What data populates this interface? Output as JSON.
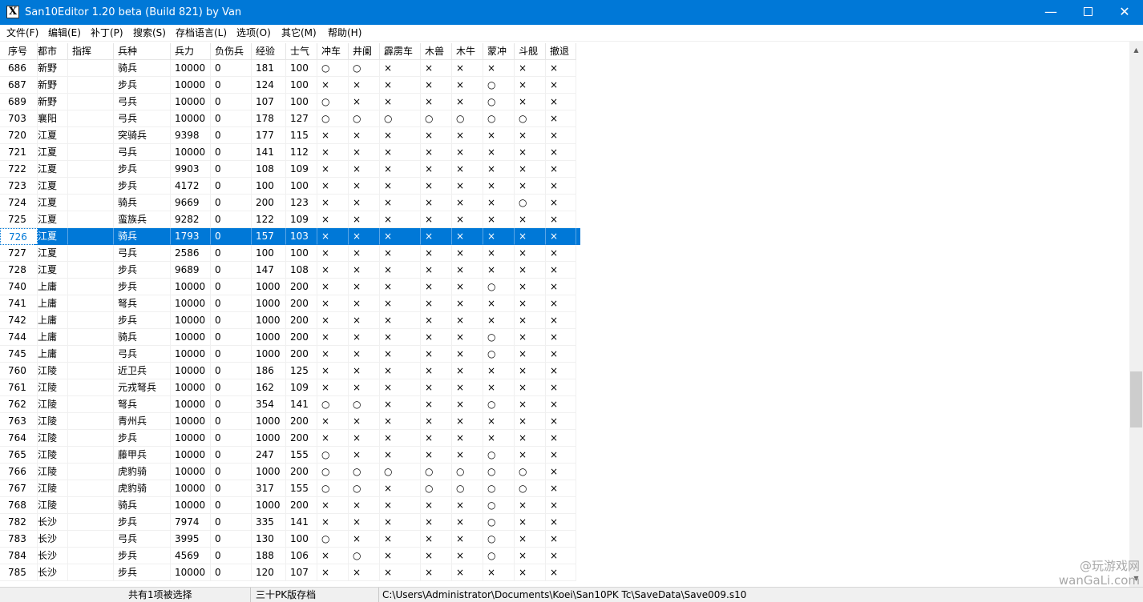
{
  "window": {
    "title": "San10Editor 1.20 beta (Build 821) by Van",
    "icon": "X",
    "minimize": "—",
    "close": "✕"
  },
  "menu": [
    "文件(F)",
    "编辑(E)",
    "补丁(P)",
    "搜索(S)",
    "存档语言(L)",
    "选项(O)",
    "其它(M)",
    "帮助(H)"
  ],
  "table": {
    "columns": [
      "序号",
      "都市",
      "指挥",
      "兵种",
      "兵力",
      "负伤兵",
      "经验",
      "士气",
      "冲车",
      "井阑",
      "霹雳车",
      "木兽",
      "木牛",
      "蒙冲",
      "斗舰",
      "撤退"
    ],
    "rows": [
      [
        "686",
        "新野",
        "",
        "骑兵",
        "10000",
        "0",
        "181",
        "100",
        "○",
        "○",
        "×",
        "×",
        "×",
        "×",
        "×",
        "×"
      ],
      [
        "687",
        "新野",
        "",
        "步兵",
        "10000",
        "0",
        "124",
        "100",
        "×",
        "×",
        "×",
        "×",
        "×",
        "○",
        "×",
        "×"
      ],
      [
        "689",
        "新野",
        "",
        "弓兵",
        "10000",
        "0",
        "107",
        "100",
        "○",
        "×",
        "×",
        "×",
        "×",
        "○",
        "×",
        "×"
      ],
      [
        "703",
        "襄阳",
        "",
        "弓兵",
        "10000",
        "0",
        "178",
        "127",
        "○",
        "○",
        "○",
        "○",
        "○",
        "○",
        "○",
        "×"
      ],
      [
        "720",
        "江夏",
        "",
        "突骑兵",
        "9398",
        "0",
        "177",
        "115",
        "×",
        "×",
        "×",
        "×",
        "×",
        "×",
        "×",
        "×"
      ],
      [
        "721",
        "江夏",
        "",
        "弓兵",
        "10000",
        "0",
        "141",
        "112",
        "×",
        "×",
        "×",
        "×",
        "×",
        "×",
        "×",
        "×"
      ],
      [
        "722",
        "江夏",
        "",
        "步兵",
        "9903",
        "0",
        "108",
        "109",
        "×",
        "×",
        "×",
        "×",
        "×",
        "×",
        "×",
        "×"
      ],
      [
        "723",
        "江夏",
        "",
        "步兵",
        "4172",
        "0",
        "100",
        "100",
        "×",
        "×",
        "×",
        "×",
        "×",
        "×",
        "×",
        "×"
      ],
      [
        "724",
        "江夏",
        "",
        "骑兵",
        "9669",
        "0",
        "200",
        "123",
        "×",
        "×",
        "×",
        "×",
        "×",
        "×",
        "○",
        "×"
      ],
      [
        "725",
        "江夏",
        "",
        "蛮族兵",
        "9282",
        "0",
        "122",
        "109",
        "×",
        "×",
        "×",
        "×",
        "×",
        "×",
        "×",
        "×"
      ],
      [
        "726",
        "江夏",
        "",
        "骑兵",
        "1793",
        "0",
        "157",
        "103",
        "×",
        "×",
        "×",
        "×",
        "×",
        "×",
        "×",
        "×"
      ],
      [
        "727",
        "江夏",
        "",
        "弓兵",
        "2586",
        "0",
        "100",
        "100",
        "×",
        "×",
        "×",
        "×",
        "×",
        "×",
        "×",
        "×"
      ],
      [
        "728",
        "江夏",
        "",
        "步兵",
        "9689",
        "0",
        "147",
        "108",
        "×",
        "×",
        "×",
        "×",
        "×",
        "×",
        "×",
        "×"
      ],
      [
        "740",
        "上庸",
        "",
        "步兵",
        "10000",
        "0",
        "1000",
        "200",
        "×",
        "×",
        "×",
        "×",
        "×",
        "○",
        "×",
        "×"
      ],
      [
        "741",
        "上庸",
        "",
        "弩兵",
        "10000",
        "0",
        "1000",
        "200",
        "×",
        "×",
        "×",
        "×",
        "×",
        "×",
        "×",
        "×"
      ],
      [
        "742",
        "上庸",
        "",
        "步兵",
        "10000",
        "0",
        "1000",
        "200",
        "×",
        "×",
        "×",
        "×",
        "×",
        "×",
        "×",
        "×"
      ],
      [
        "744",
        "上庸",
        "",
        "骑兵",
        "10000",
        "0",
        "1000",
        "200",
        "×",
        "×",
        "×",
        "×",
        "×",
        "○",
        "×",
        "×"
      ],
      [
        "745",
        "上庸",
        "",
        "弓兵",
        "10000",
        "0",
        "1000",
        "200",
        "×",
        "×",
        "×",
        "×",
        "×",
        "○",
        "×",
        "×"
      ],
      [
        "760",
        "江陵",
        "",
        "近卫兵",
        "10000",
        "0",
        "186",
        "125",
        "×",
        "×",
        "×",
        "×",
        "×",
        "×",
        "×",
        "×"
      ],
      [
        "761",
        "江陵",
        "",
        "元戎弩兵",
        "10000",
        "0",
        "162",
        "109",
        "×",
        "×",
        "×",
        "×",
        "×",
        "×",
        "×",
        "×"
      ],
      [
        "762",
        "江陵",
        "",
        "弩兵",
        "10000",
        "0",
        "354",
        "141",
        "○",
        "○",
        "×",
        "×",
        "×",
        "○",
        "×",
        "×"
      ],
      [
        "763",
        "江陵",
        "",
        "青州兵",
        "10000",
        "0",
        "1000",
        "200",
        "×",
        "×",
        "×",
        "×",
        "×",
        "×",
        "×",
        "×"
      ],
      [
        "764",
        "江陵",
        "",
        "步兵",
        "10000",
        "0",
        "1000",
        "200",
        "×",
        "×",
        "×",
        "×",
        "×",
        "×",
        "×",
        "×"
      ],
      [
        "765",
        "江陵",
        "",
        "藤甲兵",
        "10000",
        "0",
        "247",
        "155",
        "○",
        "×",
        "×",
        "×",
        "×",
        "○",
        "×",
        "×"
      ],
      [
        "766",
        "江陵",
        "",
        "虎豹骑",
        "10000",
        "0",
        "1000",
        "200",
        "○",
        "○",
        "○",
        "○",
        "○",
        "○",
        "○",
        "×"
      ],
      [
        "767",
        "江陵",
        "",
        "虎豹骑",
        "10000",
        "0",
        "317",
        "155",
        "○",
        "○",
        "×",
        "○",
        "○",
        "○",
        "○",
        "×"
      ],
      [
        "768",
        "江陵",
        "",
        "骑兵",
        "10000",
        "0",
        "1000",
        "200",
        "×",
        "×",
        "×",
        "×",
        "×",
        "○",
        "×",
        "×"
      ],
      [
        "782",
        "长沙",
        "",
        "步兵",
        "7974",
        "0",
        "335",
        "141",
        "×",
        "×",
        "×",
        "×",
        "×",
        "○",
        "×",
        "×"
      ],
      [
        "783",
        "长沙",
        "",
        "弓兵",
        "3995",
        "0",
        "130",
        "100",
        "○",
        "×",
        "×",
        "×",
        "×",
        "○",
        "×",
        "×"
      ],
      [
        "784",
        "长沙",
        "",
        "步兵",
        "4569",
        "0",
        "188",
        "106",
        "×",
        "○",
        "×",
        "×",
        "×",
        "○",
        "×",
        "×"
      ],
      [
        "785",
        "长沙",
        "",
        "步兵",
        "10000",
        "0",
        "120",
        "107",
        "×",
        "×",
        "×",
        "×",
        "×",
        "×",
        "×",
        "×"
      ]
    ],
    "selected_row": "726"
  },
  "status": {
    "selection": "共有1项被选择",
    "edition": "三十PK版存档",
    "path": "C:\\Users\\Administrator\\Documents\\Koei\\San10PK Tc\\SaveData\\Save009.s10"
  },
  "watermark": {
    "line1": "@玩游戏网",
    "line2": "wanGaLi.com"
  },
  "colors": {
    "titlebar": "#0078d7",
    "selection": "#0078d7"
  }
}
